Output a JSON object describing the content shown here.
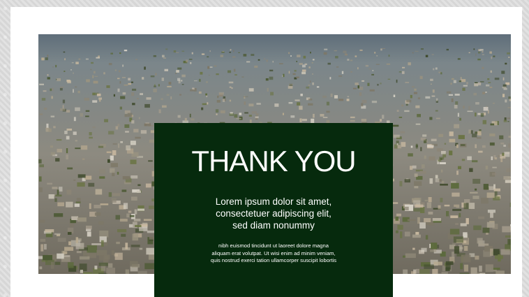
{
  "slide": {
    "title": "THANK YOU",
    "subtitle_lines": [
      "Lorem ipsum dolor sit amet,",
      "consectetuer adipiscing elit,",
      "sed diam nonummy"
    ],
    "body_lines": [
      "nibh euismod tincidunt ut laoreet dolore magna",
      "aliquam erat volutpat. Ut wisi enim ad minim veniam,",
      "quis nostrud exerci tation ullamcorper suscipit lobortis"
    ]
  },
  "colors": {
    "panel": "#062a0d",
    "text": "#ffffff",
    "card": "#ffffff",
    "backdrop": "#dcdcdc"
  }
}
